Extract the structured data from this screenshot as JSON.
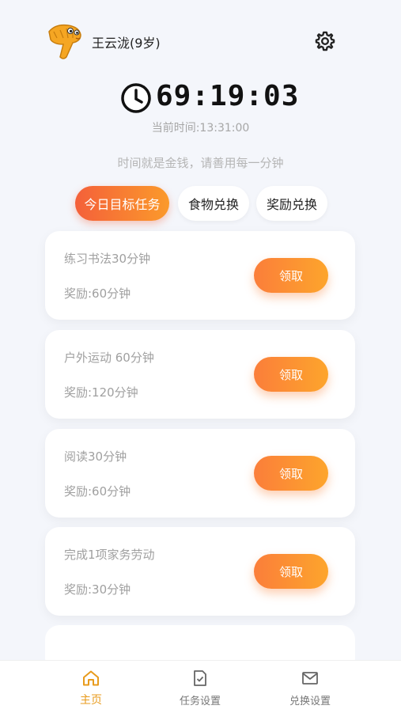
{
  "user": {
    "name": "王云泷(9岁)",
    "avatar_icon": "snake-avatar-icon"
  },
  "settings_icon": "gear-icon",
  "timer": {
    "value": "69:19:03",
    "icon": "clock-icon"
  },
  "current_time": "当前时间:13:31:00",
  "slogan": "时间就是金钱，请善用每一分钟",
  "tabs": [
    {
      "label": "今日目标任务",
      "active": true
    },
    {
      "label": "食物兑换",
      "active": false
    },
    {
      "label": "奖励兑换",
      "active": false
    }
  ],
  "tasks": [
    {
      "title": "练习书法30分钟",
      "reward": "奖励:60分钟",
      "button": "领取"
    },
    {
      "title": "户外运动 60分钟",
      "reward": "奖励:120分钟",
      "button": "领取"
    },
    {
      "title": "阅读30分钟",
      "reward": "奖励:60分钟",
      "button": "领取"
    },
    {
      "title": "完成1项家务劳动",
      "reward": "奖励:30分钟",
      "button": "领取"
    }
  ],
  "nav": [
    {
      "label": "主页",
      "icon": "home-icon",
      "active": true
    },
    {
      "label": "任务设置",
      "icon": "task-check-icon",
      "active": false
    },
    {
      "label": "兑换设置",
      "icon": "mail-icon",
      "active": false
    }
  ],
  "colors": {
    "accent": "#f4603a",
    "accent_end": "#fb9a2b",
    "nav_active": "#e89b1c",
    "background": "#f4f6fb"
  }
}
